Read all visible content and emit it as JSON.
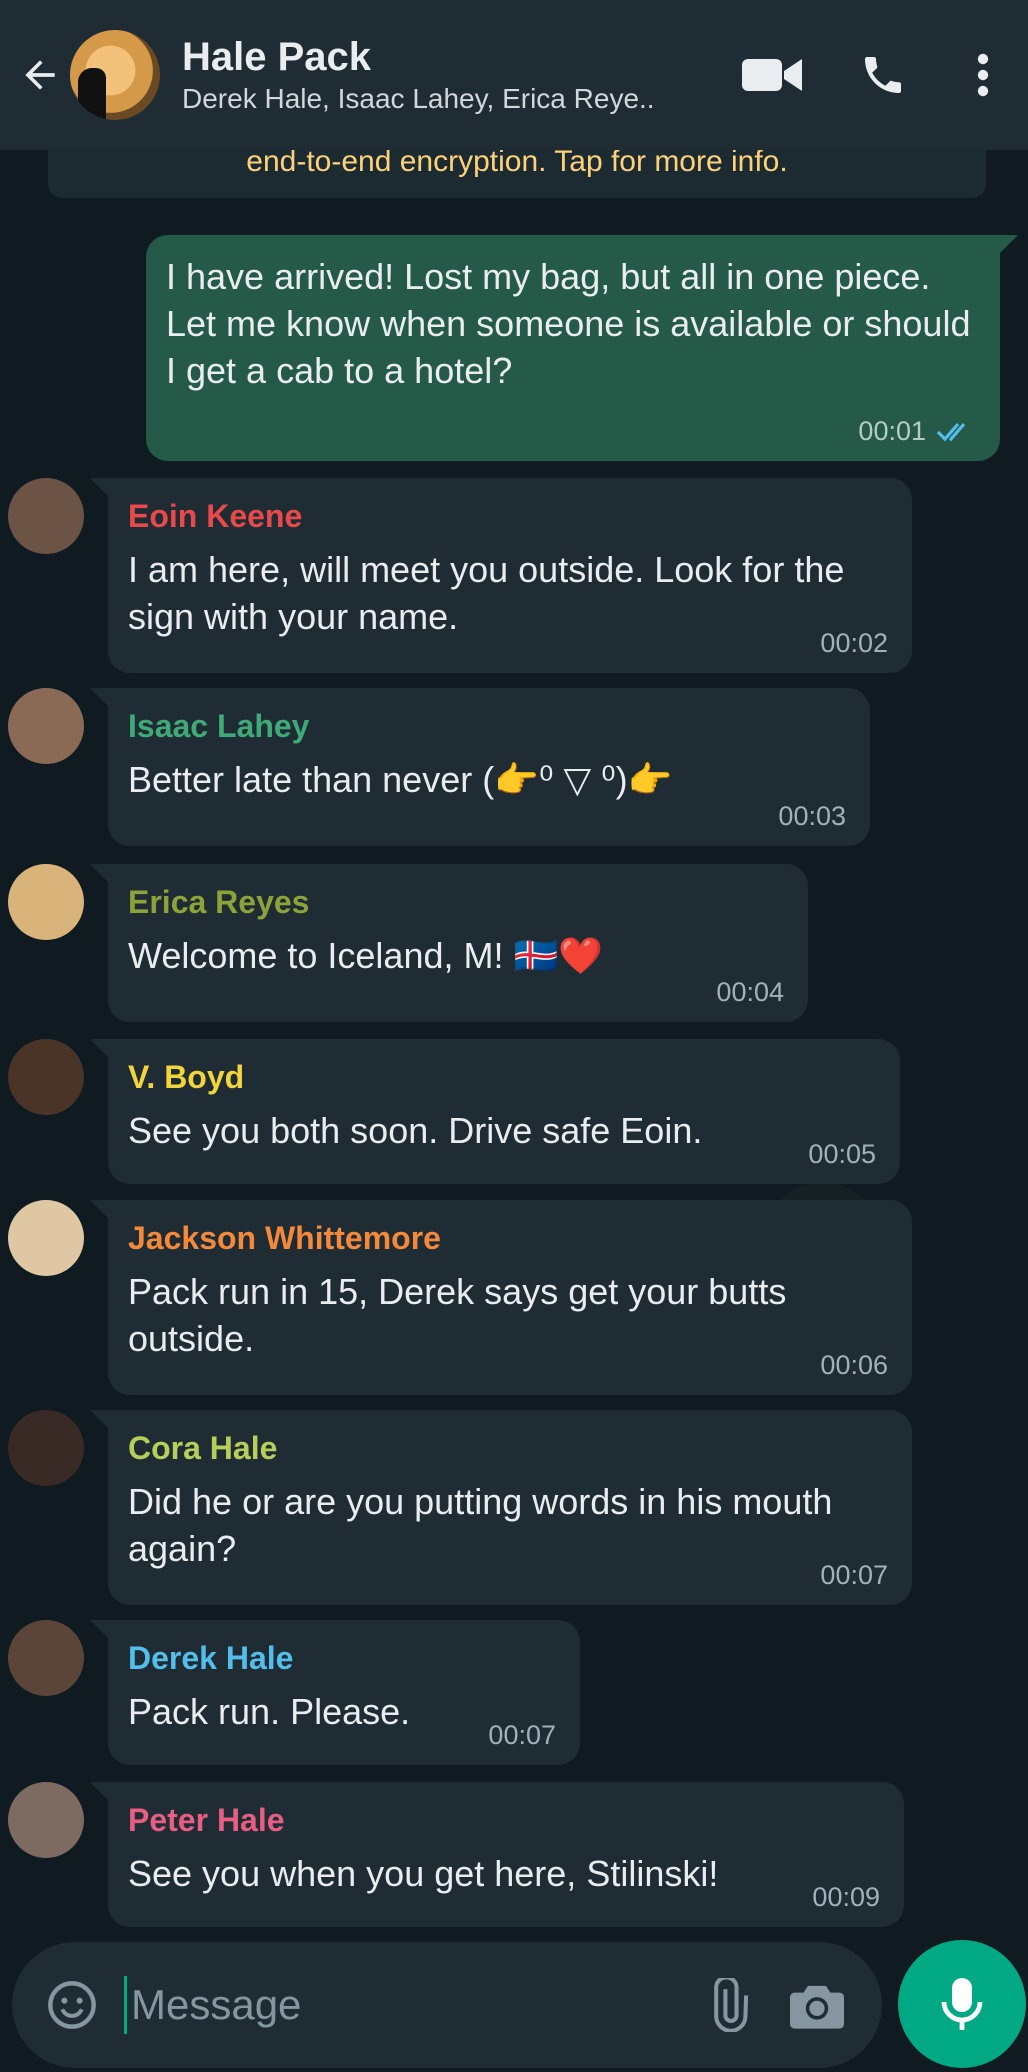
{
  "header": {
    "title": "Hale Pack",
    "subtitle": "Derek Hale, Isaac Lahey, Erica Reye.."
  },
  "encryption_notice": "end-to-end encryption. Tap for more info.",
  "outgoing": {
    "text": "I have arrived! Lost my bag, but all in one piece. Let me know when someone is available or should I get a cab to a hotel?",
    "time": "00:01"
  },
  "messages": [
    {
      "sender": "Eoin Keene",
      "color": "#e8494a",
      "text": "I am here, will meet you outside. Look for the sign with your name.",
      "time": "00:02",
      "avatar": "#6b5446"
    },
    {
      "sender": "Isaac Lahey",
      "color": "#3fa977",
      "text": "Better late than never (👉⁰ ▽ ⁰)👉",
      "time": "00:03",
      "avatar": "#8a6a55"
    },
    {
      "sender": "Erica Reyes",
      "color": "#8da33a",
      "text": "Welcome to Iceland, M! 🇮🇸❤️",
      "time": "00:04",
      "avatar": "#d9b47a"
    },
    {
      "sender": "V. Boyd",
      "color": "#f2d53a",
      "text": "See you both soon. Drive safe Eoin.",
      "time": "00:05",
      "avatar": "#4a3428"
    },
    {
      "sender": "Jackson Whittemore",
      "color": "#f5893b",
      "text": "Pack run in 15, Derek says get your butts outside.",
      "time": "00:06",
      "avatar": "#e0c7a3"
    },
    {
      "sender": "Cora Hale",
      "color": "#b6cf5a",
      "text": "Did he or are you putting words in his mouth again?",
      "time": "00:07",
      "avatar": "#3a2a26"
    },
    {
      "sender": "Derek Hale",
      "color": "#53bdeb",
      "text": "Pack run. Please.",
      "time": "00:07",
      "avatar": "#5a4538"
    },
    {
      "sender": "Peter Hale",
      "color": "#e85d82",
      "text": "See you when you get here, Stilinski!",
      "time": "00:09",
      "avatar": "#7d6b62"
    }
  ],
  "composer": {
    "placeholder": "Message"
  }
}
